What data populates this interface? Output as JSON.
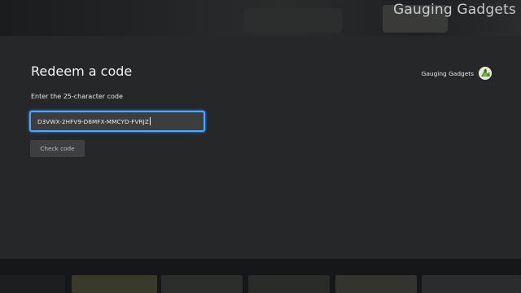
{
  "watermark": {
    "text": "Gauging Gadgets"
  },
  "redeem": {
    "title": "Redeem a code",
    "field_label": "Enter the 25-character code",
    "code_value": "D3VWX-2HFV9-D6MFX-MMCYD-FVRJZ",
    "check_button_label": "Check code"
  },
  "account": {
    "gamertag": "Gauging Gadgets",
    "avatar_icon": "profile-avatar-icon"
  },
  "colors": {
    "panel_bg": "#252729",
    "focus_ring": "#4fa6ff",
    "input_bg": "#3b3d3f",
    "button_bg": "#3d3f41"
  }
}
